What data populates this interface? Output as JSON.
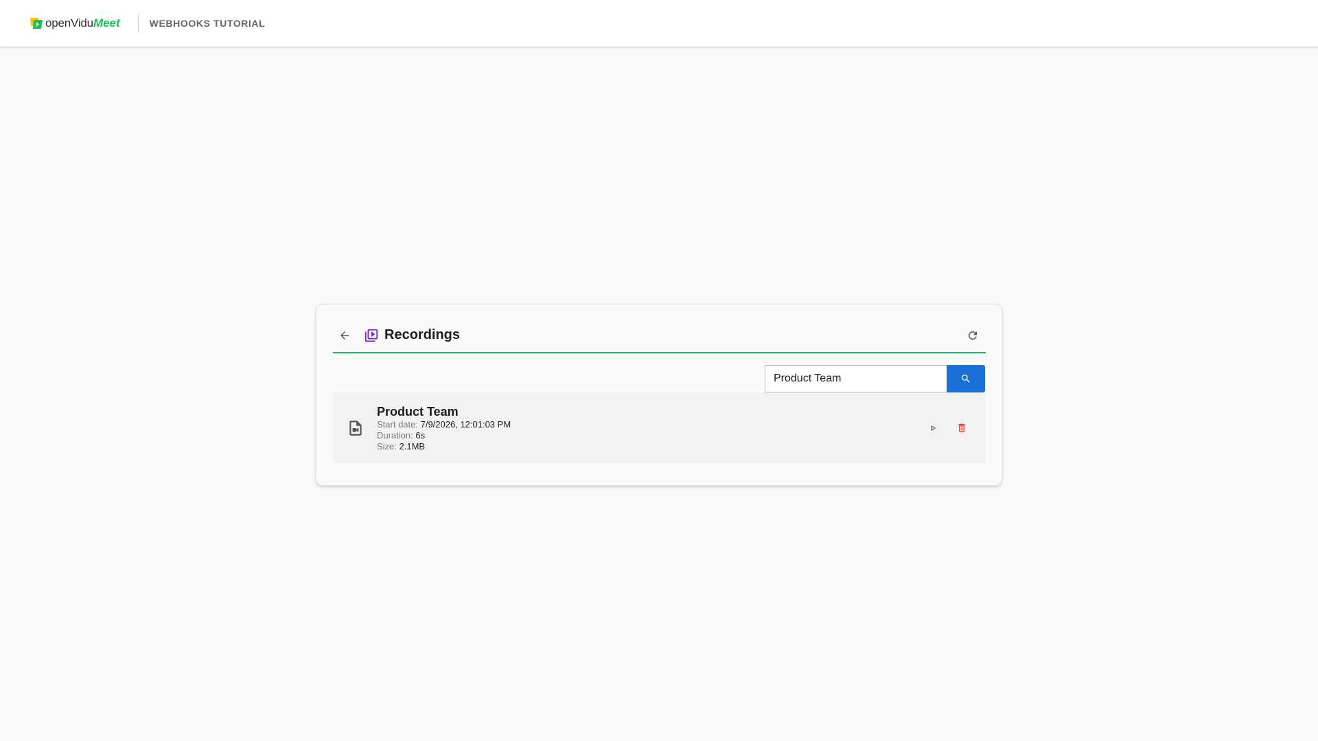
{
  "header": {
    "brand_open": "openVidu",
    "brand_meet": "Meet",
    "section_title": "WEBHOOKS TUTORIAL"
  },
  "recordings_panel": {
    "title": "Recordings",
    "back_icon": "arrow-back-icon",
    "section_icon": "video-library-icon",
    "refresh_icon": "refresh-icon"
  },
  "search": {
    "value": "Product Team",
    "button_icon": "search-icon"
  },
  "recordings": [
    {
      "name": "Product Team",
      "start_date_label": "Start date:",
      "start_date": "7/9/2026, 12:01:03 PM",
      "duration_label": "Duration:",
      "duration": "6s",
      "size_label": "Size:",
      "size": "2.1MB",
      "file_icon": "video-file-icon",
      "play_icon": "play-icon",
      "delete_icon": "delete-icon"
    }
  ],
  "colors": {
    "accent_green": "#22b55c",
    "brand_green": "#1fbf5a",
    "search_blue": "#1b6fd6",
    "delete_red": "#e53935",
    "section_icon_purple": "#7b2cbf"
  }
}
